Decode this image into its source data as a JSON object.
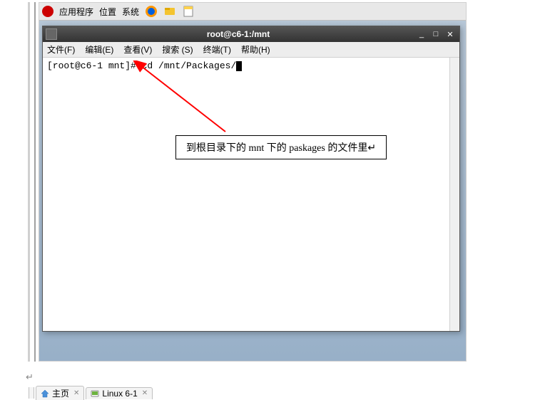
{
  "gnomePanel": {
    "menus": [
      "应用程序",
      "位置",
      "系统"
    ]
  },
  "terminal": {
    "title": "root@c6-1:/mnt",
    "menubar": [
      "文件(F)",
      "编辑(E)",
      "查看(V)",
      "搜索 (S)",
      "终端(T)",
      "帮助(H)"
    ],
    "prompt": "[root@c6-1 mnt]# ",
    "command": "cd /mnt/Packages/"
  },
  "annotation": {
    "text": "到根目录下的 mnt 下的 paskages 的文件里↵"
  },
  "bottomTabs": {
    "tab1": {
      "label": "主页"
    },
    "tab2": {
      "label": "Linux 6-1"
    }
  },
  "returnMark": "↵"
}
